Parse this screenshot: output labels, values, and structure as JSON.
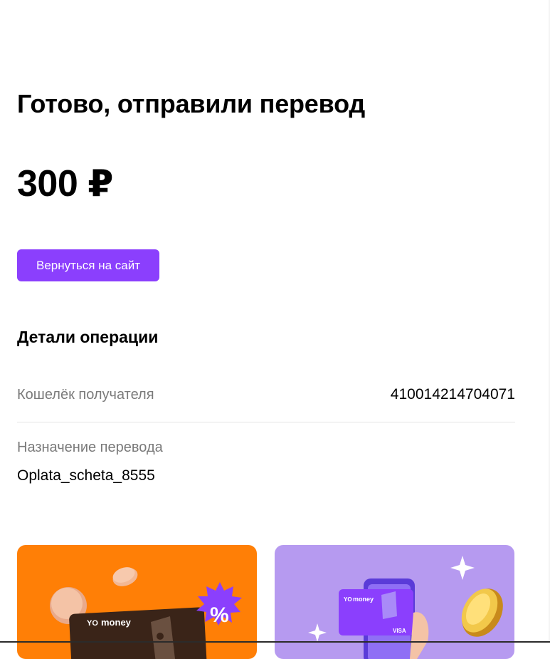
{
  "result": {
    "title": "Готово, отправили перевод",
    "amount": "300 ₽"
  },
  "actions": {
    "return_label": "Вернуться на сайт"
  },
  "details": {
    "title": "Детали операции",
    "wallet_label": "Кошелёк получателя",
    "wallet_value": "410014214704071",
    "purpose_label": "Назначение перевода",
    "purpose_value": "Oplata_scheta_8555"
  },
  "promo": {
    "card_brand": "money",
    "card_network": "VISA",
    "percent_sign": "%"
  },
  "colors": {
    "accent": "#8b3ffd",
    "banner_orange": "#ff7f06",
    "banner_purple": "#b69af0"
  }
}
